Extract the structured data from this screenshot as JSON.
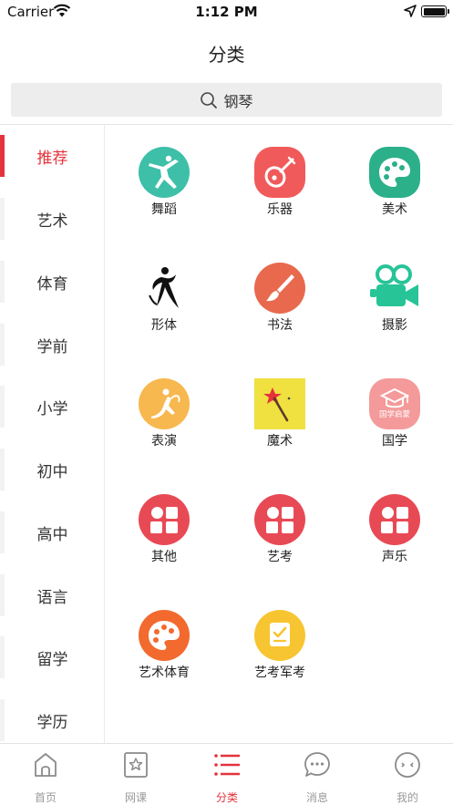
{
  "status_bar": {
    "carrier": "Carrier",
    "time": "1:12 PM"
  },
  "header": {
    "title": "分类"
  },
  "search": {
    "placeholder": "钢琴"
  },
  "sidebar": {
    "items": [
      {
        "label": "推荐",
        "active": true
      },
      {
        "label": "艺术"
      },
      {
        "label": "体育"
      },
      {
        "label": "学前"
      },
      {
        "label": "小学"
      },
      {
        "label": "初中"
      },
      {
        "label": "高中"
      },
      {
        "label": "语言"
      },
      {
        "label": "留学"
      },
      {
        "label": "学历"
      }
    ]
  },
  "categories": {
    "items": [
      {
        "label": "舞蹈",
        "icon": "dance-icon",
        "color": "#3dbfa8"
      },
      {
        "label": "乐器",
        "icon": "pipa-instrument-icon",
        "color": "#f15a5a"
      },
      {
        "label": "美术",
        "icon": "palette-icon",
        "color": "#2bb08a"
      },
      {
        "label": "形体",
        "icon": "body-figure-icon",
        "color": "#111111"
      },
      {
        "label": "书法",
        "icon": "brush-icon",
        "color": "#e8694e"
      },
      {
        "label": "摄影",
        "icon": "video-camera-icon",
        "color": "#27c497"
      },
      {
        "label": "表演",
        "icon": "performance-icon",
        "color": "#f7b84f"
      },
      {
        "label": "魔术",
        "icon": "magic-wand-icon",
        "color": "#f0e040"
      },
      {
        "label": "国学",
        "icon": "graduation-cap-icon",
        "color": "#f49a9a",
        "icon_text": "国学启蒙"
      },
      {
        "label": "其他",
        "icon": "grid-blocks-icon",
        "color": "#e84a55"
      },
      {
        "label": "艺考",
        "icon": "grid-blocks-icon",
        "color": "#e84a55"
      },
      {
        "label": "声乐",
        "icon": "grid-blocks-icon",
        "color": "#e84a55"
      },
      {
        "label": "艺术体育",
        "icon": "palette-icon",
        "color": "#f26a2e"
      },
      {
        "label": "艺考军考",
        "icon": "checklist-icon",
        "color": "#f7c531"
      }
    ]
  },
  "tabbar": {
    "items": [
      {
        "label": "首页",
        "icon": "home-icon"
      },
      {
        "label": "网课",
        "icon": "star-bookmark-icon"
      },
      {
        "label": "分类",
        "icon": "list-icon",
        "active": true
      },
      {
        "label": "消息",
        "icon": "chat-bubble-icon"
      },
      {
        "label": "我的",
        "icon": "face-icon"
      }
    ]
  },
  "colors": {
    "accent": "#e5323b",
    "tab_inactive": "#9a9a9a"
  }
}
